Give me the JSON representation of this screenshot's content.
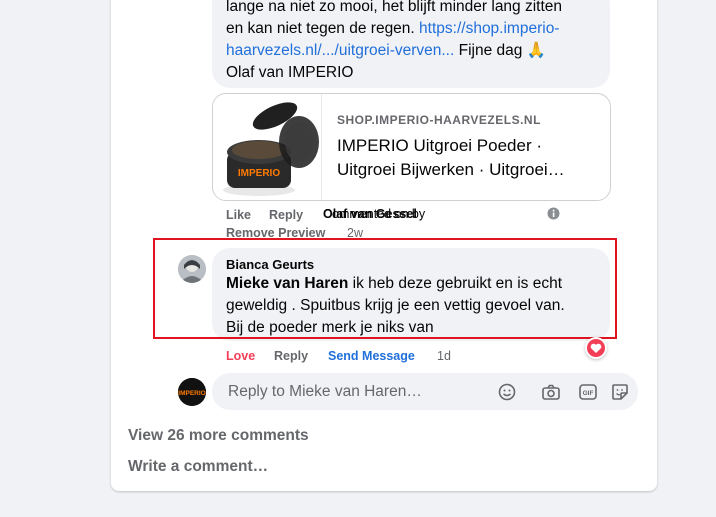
{
  "top_comment": {
    "text_line1": "lange na niet zo mooi, het blijft minder lang zitten",
    "text_line2_prefix": "en kan niet tegen de regen. ",
    "link_part1": "https://shop.imperio-",
    "link_part2": "haarvezels.nl/.../uitgroei-verven...",
    "text_suffix": " Fijne dag 🙏",
    "signature": "Olaf van IMPERIO"
  },
  "link_preview": {
    "domain": "SHOP.IMPERIO-HAARVEZELS.NL",
    "title": "IMPERIO Uitgroei Poeder · Uitgroei Bijwerken · Uitgroei…",
    "thumb_brand": "IMPERIO"
  },
  "top_actions": {
    "like": "Like",
    "reply": "Reply",
    "commented_on_by": "Commented on by",
    "commenter": "Olaf van Gessel",
    "remove_preview": "Remove Preview",
    "time": "2w"
  },
  "reply_comment": {
    "author": "Bianca Geurts",
    "mention": "Mieke van Haren",
    "text_line1": " ik heb deze gebruikt en is echt",
    "text_line2": "geweldig . Spuitbus krijg je een vettig gevoel van.",
    "text_line3": "Bij de poeder merk je niks van"
  },
  "reply_actions": {
    "love": "Love",
    "reply": "Reply",
    "send_message": "Send Message",
    "time": "1d"
  },
  "reply_box": {
    "placeholder": "Reply to Mieke van Haren…",
    "avatar_brand": "IMPERIO"
  },
  "more_comments": "View 26 more comments",
  "write_comment": "Write a comment…",
  "colors": {
    "link": "#216fdb",
    "love": "#f33e58",
    "highlight": "#e0141e",
    "muted": "#65676b",
    "bubble": "#f0f2f5"
  },
  "icons": [
    "info-icon",
    "love-reaction-icon",
    "emoji-icon",
    "camera-icon",
    "gif-icon",
    "sticker-icon"
  ]
}
